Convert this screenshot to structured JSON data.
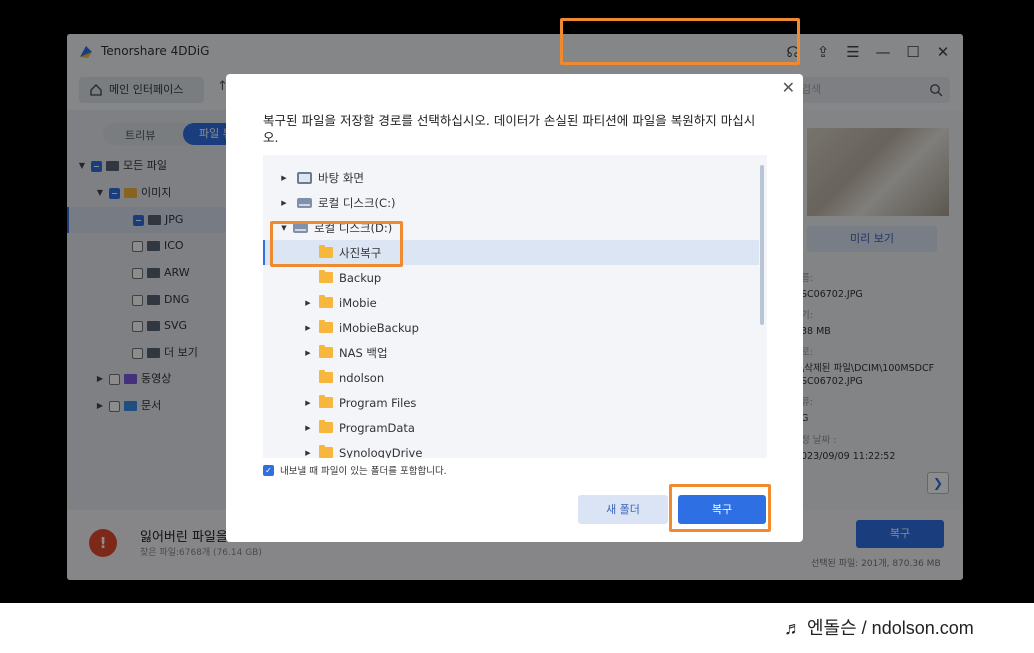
{
  "app": {
    "title": "Tenorshare 4DDiG",
    "home_label": "메인 인터페이스",
    "search_placeholder": "검색"
  },
  "left": {
    "tab_tree": "트리뷰",
    "tab_file": "파일 뷰",
    "items": [
      {
        "label": "모든 파일"
      },
      {
        "label": "이미지"
      },
      {
        "label": "JPG"
      },
      {
        "label": "ICO"
      },
      {
        "label": "ARW"
      },
      {
        "label": "DNG"
      },
      {
        "label": "SVG"
      },
      {
        "label": "더 보기"
      },
      {
        "label": "동영상"
      },
      {
        "label": "문서"
      }
    ]
  },
  "right": {
    "preview_label": "미리 보기",
    "meta": {
      "name_label": "름:",
      "name_value": "SC06702.JPG",
      "size_label": "기:",
      "size_value": "38 MB",
      "path_label": "로:",
      "path_value1": "\\삭제된 파일\\DCIM\\100MSDCF",
      "path_value2": "SC06702.JPG",
      "type_label": "류:",
      "type_value": "G",
      "date_label": "정 날짜 :",
      "date_value": "023/09/09 11:22:52"
    }
  },
  "bottom": {
    "lost_title": "잃어버린 파일을",
    "lost_sub": "찾은 파일:6768개 (76.14 GB)",
    "recover_label": "복구",
    "selected_info": "선택된 파일: 201개, 870.36 MB"
  },
  "dialog": {
    "message": "복구된 파일을 저장할 경로를 선택하십시오. 데이터가 손실된 파티션에 파일을 복원하지 마십시오.",
    "tree": [
      {
        "label": "바탕 화면"
      },
      {
        "label": "로컬 디스크(C:)"
      },
      {
        "label": "로컬 디스크(D:)"
      },
      {
        "label": "사진복구"
      },
      {
        "label": "Backup"
      },
      {
        "label": "iMobie"
      },
      {
        "label": "iMobieBackup"
      },
      {
        "label": "NAS 백업"
      },
      {
        "label": "ndolson"
      },
      {
        "label": "Program Files"
      },
      {
        "label": "ProgramData"
      },
      {
        "label": "SynologyDrive"
      }
    ],
    "include_folder_label": "내보낼 때 파일이 있는 폴더를 포함합니다.",
    "new_folder_label": "새 폴더",
    "recover_label": "복구"
  },
  "watermark": "♬ 엔돌슨 / ndolson.com",
  "colors": {
    "accent": "#2f6fe4",
    "highlight": "#f08a30",
    "warning": "#e34b31"
  }
}
